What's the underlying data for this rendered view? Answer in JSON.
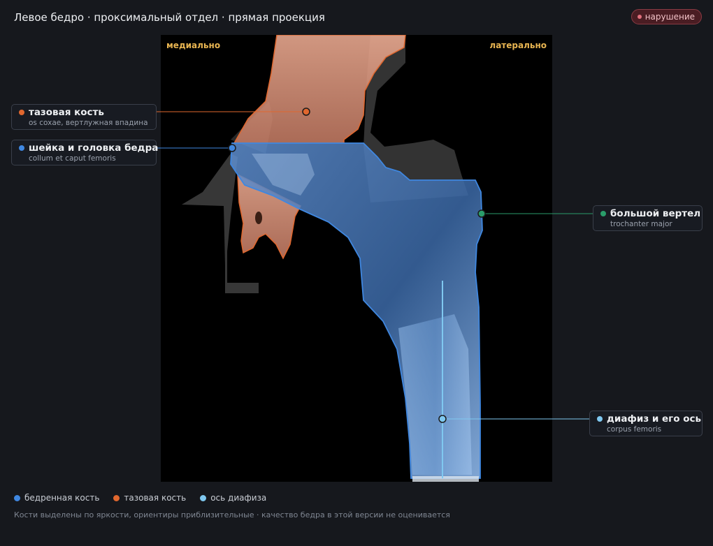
{
  "header": {
    "title": "Левое бедро · проксимальный отдел · прямая проекция",
    "badge": "нарушение"
  },
  "image": {
    "orientation_left": "медиально",
    "orientation_right": "латерально"
  },
  "callouts": {
    "pelvis": {
      "label": "тазовая кость",
      "sublabel": "os coxae, вертлужная впадина",
      "color": "#e0672e"
    },
    "neck": {
      "label": "шейка и головка бедра",
      "sublabel": "collum et caput femoris",
      "color": "#3f87e0"
    },
    "trochanter": {
      "label": "большой вертел",
      "sublabel": "trochanter major",
      "color": "#2a9d6a"
    },
    "shaft": {
      "label": "диафиз и его ось",
      "sublabel": "corpus femoris",
      "color": "#7fc8f0"
    }
  },
  "legend": [
    {
      "label": "бедренная кость",
      "color": "#3f87e0"
    },
    {
      "label": "тазовая кость",
      "color": "#e0672e"
    },
    {
      "label": "ось диафиза",
      "color": "#7fc8f0"
    }
  ],
  "footnote": "Кости выделены по яркости, ориентиры приблизительные · качество бедра в этой версии не оценивается"
}
